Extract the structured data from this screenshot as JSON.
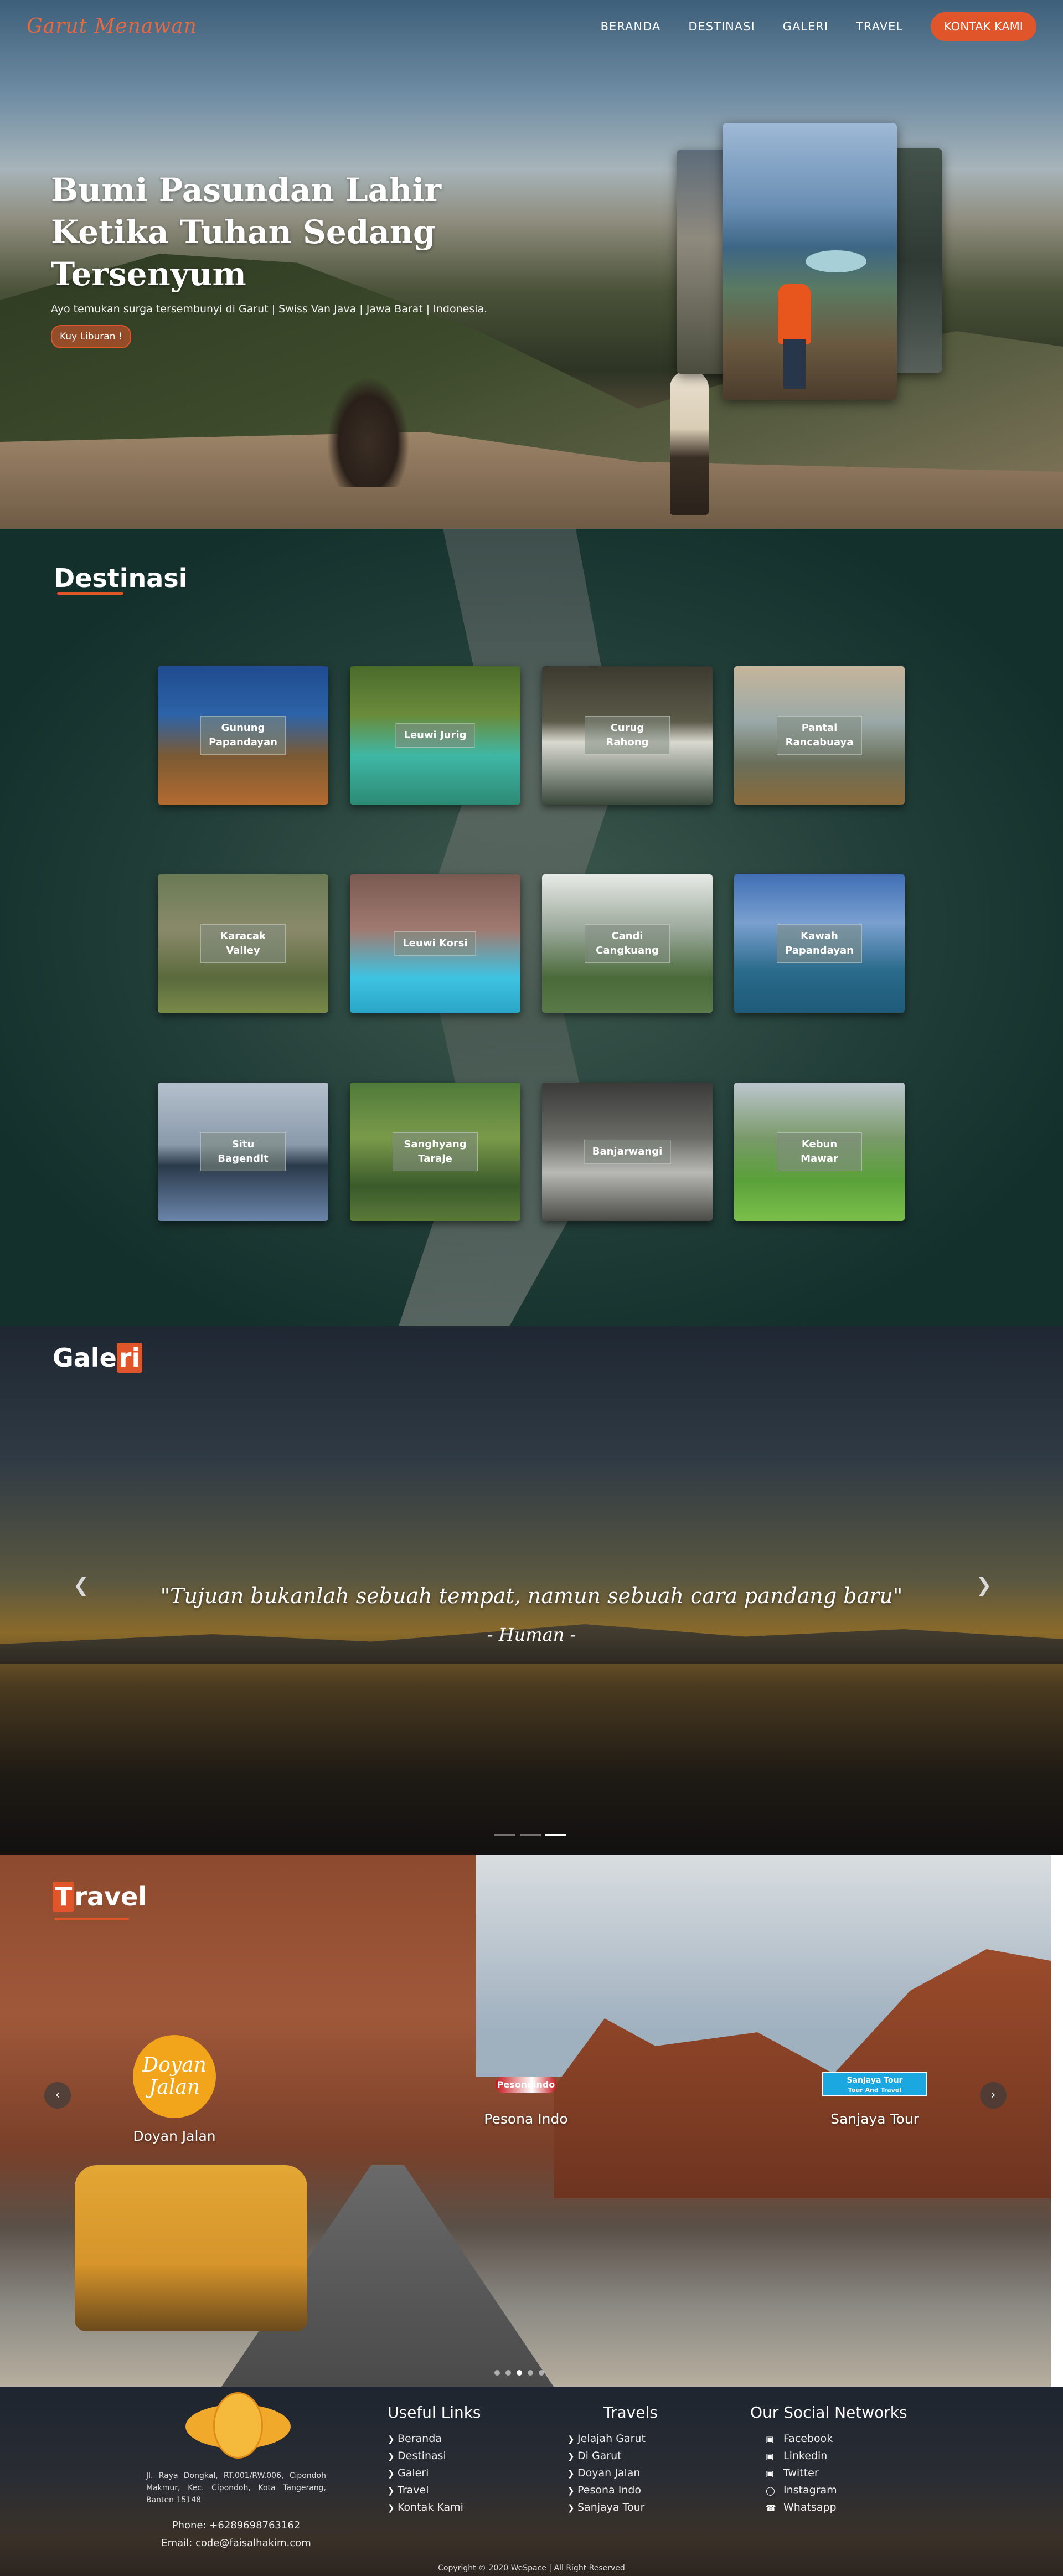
{
  "nav": {
    "brand": "Garut Menawan",
    "links": [
      "BERANDA",
      "DESTINASI",
      "GALERI",
      "TRAVEL"
    ],
    "cta": "KONTAK KAMI"
  },
  "hero": {
    "title_line1": "Bumi Pasundan Lahir",
    "title_line2": "Ketika Tuhan Sedang Tersenyum",
    "subtitle": "Ayo temukan surga tersembunyi di Garut | Swiss Van Java | Jawa Barat | Indonesia.",
    "button": "Kuy Liburan !"
  },
  "destinasi": {
    "heading": "Destinasi",
    "items": [
      {
        "label": "Gunung Papandayan",
        "bg": "linear-gradient(180deg,#1f4b8f 0%,#2d63a8 35%,#7b5a34 65%,#b26a2f 100%)"
      },
      {
        "label": "Leuwi Jurig",
        "bg": "linear-gradient(180deg,#4a6b2c 0%,#6a8b3a 35%,#3fb7a5 65%,#2c8a74 100%)"
      },
      {
        "label": "Curug Rahong",
        "bg": "linear-gradient(180deg,#3c3a30 0%,#5b5a48 40%,#d9d9d0 55%,#3b4a3c 100%)"
      },
      {
        "label": "Pantai Rancabuaya",
        "bg": "linear-gradient(180deg,#c5b59a 0%,#9aa9a8 40%,#6a6f5a 70%,#8a6a3a 100%)"
      },
      {
        "label": "Karacak Valley",
        "bg": "linear-gradient(180deg,#6a7a54 0%,#8a8a6a 40%,#5a6a3c 75%,#7a8a4a 100%)"
      },
      {
        "label": "Leuwi Korsi",
        "bg": "linear-gradient(180deg,#7a5a52 0%,#a07a70 40%,#3ec3e3 75%,#2aa5c7 100%)"
      },
      {
        "label": "Candi Cangkuang",
        "bg": "linear-gradient(180deg,#e7eae6 0%,#9aa89a 40%,#4a6a3a 75%,#5a7a4a 100%)"
      },
      {
        "label": "Kawah Papandayan",
        "bg": "linear-gradient(180deg,#3f6fb4 0%,#7aa0d0 35%,#2a6a8a 70%,#1f5a7a 100%)"
      },
      {
        "label": "Situ Bagendit",
        "bg": "linear-gradient(180deg,#b4c0cc 0%,#8a9aab 45%,#2a3a4a 60%,#6a85aa 100%)"
      },
      {
        "label": "Sanghyang Taraje",
        "bg": "linear-gradient(180deg,#4f7a3a 0%,#7a9a4a 40%,#3a5a2a 75%,#5a7a3a 100%)"
      },
      {
        "label": "Banjarwangi",
        "bg": "linear-gradient(180deg,#3a3a38 0%,#6a6a66 40%,#b8b8b4 65%,#4a4a46 100%)"
      },
      {
        "label": "Kebun Mawar",
        "bg": "linear-gradient(180deg,#bcc6cf 0%,#7a9a6a 40%,#5aa03a 70%,#7ac04a 100%)"
      }
    ]
  },
  "galeri": {
    "heading_pre": "Gale",
    "heading_hl": "ri",
    "quote": "\"Tujuan bukanlah sebuah tempat, namun sebuah cara pandang baru\"",
    "author": "- Human -",
    "prev_icon": "chevron-left-icon",
    "next_icon": "chevron-right-icon"
  },
  "travel": {
    "heading_hl": "T",
    "heading_rest": "ravel",
    "partners": [
      {
        "name": "Doyan Jalan",
        "logo_line1": "Doyan",
        "logo_line2": "Jalan"
      },
      {
        "name": "Pesona Indo",
        "logo": "Pesonaindo"
      },
      {
        "name": "Sanjaya Tour",
        "logo_line1": "Sanjaya Tour",
        "logo_line2": "Tour And Travel"
      }
    ]
  },
  "footer": {
    "address": "Jl. Raya Dongkal, RT.001/RW.006, Cipondoh Makmur, Kec. Cipondoh, Kota Tangerang, Banten 15148",
    "phone": "Phone: +6289698763162",
    "email": "Email: code@faisalhakim.com",
    "useful_links": {
      "title": "Useful Links",
      "items": [
        "Beranda",
        "Destinasi",
        "Galeri",
        "Travel",
        "Kontak Kami"
      ]
    },
    "travels": {
      "title": "Travels",
      "items": [
        "Jelajah Garut",
        "Di Garut",
        "Doyan Jalan",
        "Pesona Indo",
        "Sanjaya Tour"
      ]
    },
    "social": {
      "title": "Our Social Networks",
      "items": [
        {
          "label": "Facebook",
          "icon": "facebook-icon"
        },
        {
          "label": "Linkedin",
          "icon": "linkedin-icon"
        },
        {
          "label": "Twitter",
          "icon": "twitter-icon"
        },
        {
          "label": "Instagram",
          "icon": "instagram-icon"
        },
        {
          "label": "Whatsapp",
          "icon": "whatsapp-icon"
        }
      ]
    },
    "copyright": "Copyright © 2020 WeSpace | All Right Reserved"
  },
  "colors": {
    "accent": "#e1552b",
    "brand": "#e8683f"
  }
}
